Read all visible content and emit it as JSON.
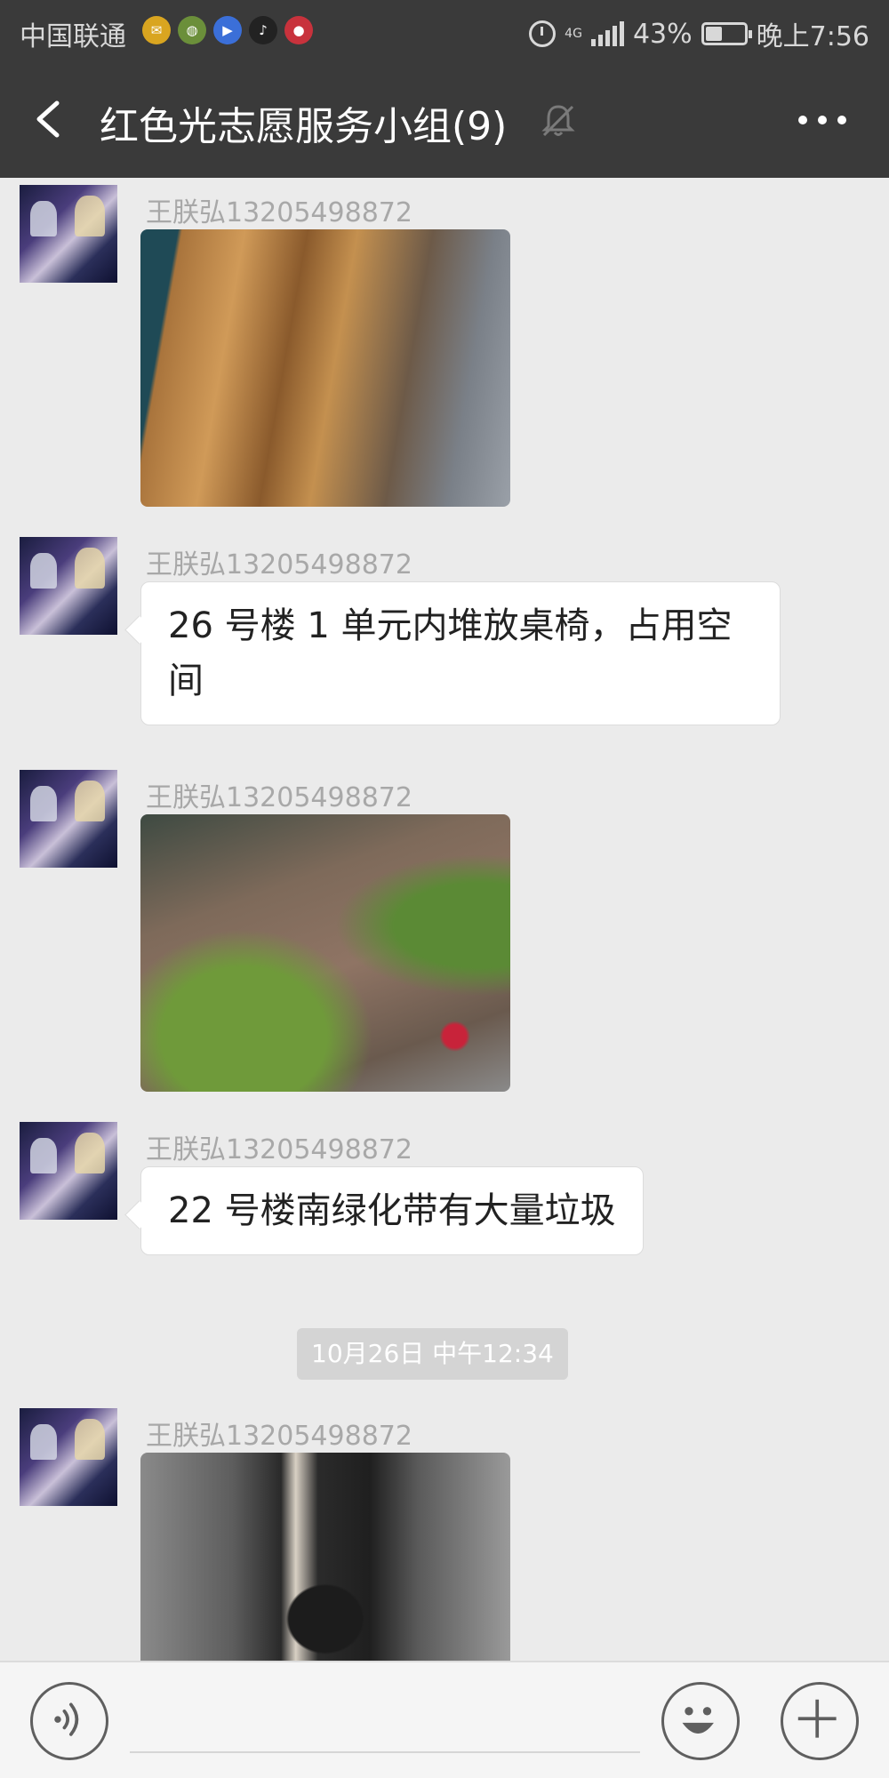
{
  "status_bar": {
    "carrier": "中国联通",
    "apps": [
      {
        "icon": "mail-app-icon",
        "glyph": "✉",
        "color": "#d9a520"
      },
      {
        "icon": "app-green-icon",
        "glyph": "◍",
        "color": "#6b8f3a"
      },
      {
        "icon": "video-app-icon",
        "glyph": "▶",
        "color": "#3b6fd8"
      },
      {
        "icon": "tiktok-icon",
        "glyph": "♪",
        "color": "#222222"
      },
      {
        "icon": "red-app-icon",
        "glyph": "●",
        "color": "#c8323c"
      }
    ],
    "network": "4G",
    "battery": "43%",
    "battery_level": 0.43,
    "time": "晚上7:56"
  },
  "header": {
    "title": "红色光志愿服务小组(9)"
  },
  "messages": [
    {
      "sender": "王朕弘13205498872",
      "type": "image",
      "image_desc": "stacked desks and chairs"
    },
    {
      "sender": "王朕弘13205498872",
      "type": "text",
      "text": "26 号楼 1 单元内堆放桌椅，占用空间"
    },
    {
      "sender": "王朕弘13205498872",
      "type": "image",
      "image_desc": "green belt with litter"
    },
    {
      "sender": "王朕弘13205498872",
      "type": "text",
      "text": "22 号楼南绿化带有大量垃圾"
    },
    {
      "timestamp": "10月26日 中午12:34"
    },
    {
      "sender": "王朕弘13205498872",
      "type": "image",
      "image_desc": "building entrance"
    }
  ],
  "colors": {
    "header_bg": "#3a3a3a",
    "chat_bg": "#ebebeb",
    "bubble_bg": "#ffffff",
    "sender_text": "#a8a8a8"
  }
}
